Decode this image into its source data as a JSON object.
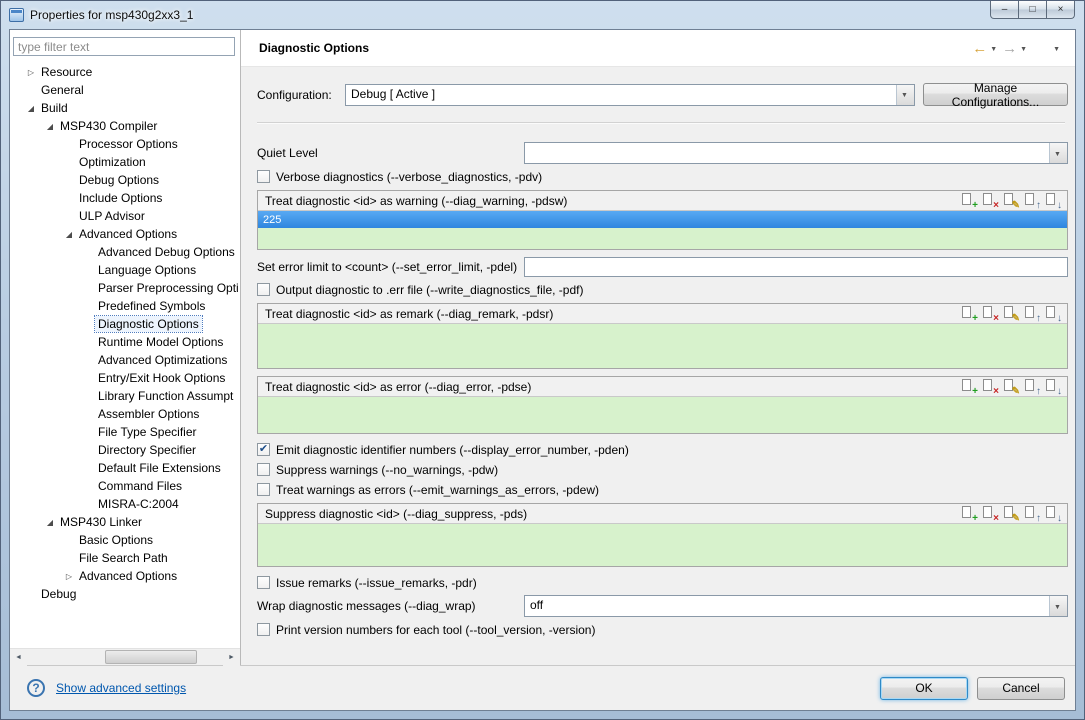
{
  "window": {
    "title": "Properties for msp430g2xx3_1",
    "minimize_glyph": "–",
    "maximize_glyph": "□",
    "close_glyph": "×"
  },
  "colors": {
    "selection_blue": "#3399ff",
    "list_green": "#d7f2cc",
    "link_blue": "#0057ae"
  },
  "sidebar": {
    "filter_text": "type filter text",
    "scroll": {
      "left_arrow": "◄",
      "right_arrow": "►"
    },
    "tree": [
      {
        "label": "Resource",
        "marker": "▷",
        "depth": 0
      },
      {
        "label": "General",
        "marker": "",
        "depth": 0
      },
      {
        "label": "Build",
        "marker": "◢",
        "depth": 0
      },
      {
        "label": "MSP430 Compiler",
        "marker": "◢",
        "depth": 1
      },
      {
        "label": "Processor Options",
        "marker": "",
        "depth": 2
      },
      {
        "label": "Optimization",
        "marker": "",
        "depth": 2
      },
      {
        "label": "Debug Options",
        "marker": "",
        "depth": 2
      },
      {
        "label": "Include Options",
        "marker": "",
        "depth": 2
      },
      {
        "label": "ULP Advisor",
        "marker": "",
        "depth": 2
      },
      {
        "label": "Advanced Options",
        "marker": "◢",
        "depth": 2
      },
      {
        "label": "Advanced Debug Options",
        "marker": "",
        "depth": 3
      },
      {
        "label": "Language Options",
        "marker": "",
        "depth": 3
      },
      {
        "label": "Parser Preprocessing Opti",
        "marker": "",
        "depth": 3
      },
      {
        "label": "Predefined Symbols",
        "marker": "",
        "depth": 3
      },
      {
        "label": "Diagnostic Options",
        "marker": "",
        "depth": 3,
        "selected": true
      },
      {
        "label": "Runtime Model Options",
        "marker": "",
        "depth": 3
      },
      {
        "label": "Advanced Optimizations",
        "marker": "",
        "depth": 3
      },
      {
        "label": "Entry/Exit Hook Options",
        "marker": "",
        "depth": 3
      },
      {
        "label": "Library Function Assumpt",
        "marker": "",
        "depth": 3
      },
      {
        "label": "Assembler Options",
        "marker": "",
        "depth": 3
      },
      {
        "label": "File Type Specifier",
        "marker": "",
        "depth": 3
      },
      {
        "label": "Directory Specifier",
        "marker": "",
        "depth": 3
      },
      {
        "label": "Default File Extensions",
        "marker": "",
        "depth": 3
      },
      {
        "label": "Command Files",
        "marker": "",
        "depth": 3
      },
      {
        "label": "MISRA-C:2004",
        "marker": "",
        "depth": 3
      },
      {
        "label": "MSP430 Linker",
        "marker": "◢",
        "depth": 1
      },
      {
        "label": "Basic Options",
        "marker": "",
        "depth": 2
      },
      {
        "label": "File Search Path",
        "marker": "",
        "depth": 2
      },
      {
        "label": "Advanced Options",
        "marker": "▷",
        "depth": 2
      },
      {
        "label": "Debug",
        "marker": "",
        "depth": 0
      }
    ]
  },
  "main": {
    "title": "Diagnostic Options",
    "nav": {
      "back": "←",
      "forward": "→",
      "caret": "▼"
    },
    "check_glyph": "✔",
    "configuration": {
      "label": "Configuration:",
      "value": "Debug  [ Active ]",
      "manage_button": "Manage Configurations..."
    },
    "quiet_level": {
      "label": "Quiet Level",
      "value": ""
    },
    "checkboxes": {
      "verbose": {
        "label": "Verbose diagnostics (--verbose_diagnostics, -pdv)",
        "checked": false
      },
      "output_err": {
        "label": "Output diagnostic to .err file (--write_diagnostics_file, -pdf)",
        "checked": false
      },
      "emit_ids": {
        "label": "Emit diagnostic identifier numbers (--display_error_number, -pden)",
        "checked": true
      },
      "suppress_warnings": {
        "label": "Suppress warnings (--no_warnings, -pdw)",
        "checked": false
      },
      "warnings_as_errors": {
        "label": "Treat warnings as errors (--emit_warnings_as_errors, -pdew)",
        "checked": false
      },
      "issue_remarks": {
        "label": "Issue remarks (--issue_remarks, -pdr)",
        "checked": false
      },
      "print_version": {
        "label": "Print version numbers for each tool (--tool_version, -version)",
        "checked": false
      }
    },
    "groups": {
      "warning": {
        "title": "Treat diagnostic <id> as warning (--diag_warning, -pdsw)",
        "items": [
          "225"
        ]
      },
      "remark": {
        "title": "Treat diagnostic <id> as remark (--diag_remark, -pdsr)",
        "items": []
      },
      "error": {
        "title": "Treat diagnostic <id> as error (--diag_error, -pdse)",
        "items": []
      },
      "suppress": {
        "title": "Suppress diagnostic <id> (--diag_suppress, -pds)",
        "items": []
      }
    },
    "error_limit": {
      "label": "Set error limit to <count> (--set_error_limit, -pdel)",
      "value": ""
    },
    "wrap": {
      "label": "Wrap diagnostic messages (--diag_wrap)",
      "value": "off"
    },
    "toolbar_icons": {
      "add": "+",
      "delete": "×",
      "edit": "✎",
      "up": "↑",
      "down": "↓"
    }
  },
  "footer": {
    "help": "?",
    "link": "Show advanced settings",
    "ok": "OK",
    "cancel": "Cancel"
  }
}
